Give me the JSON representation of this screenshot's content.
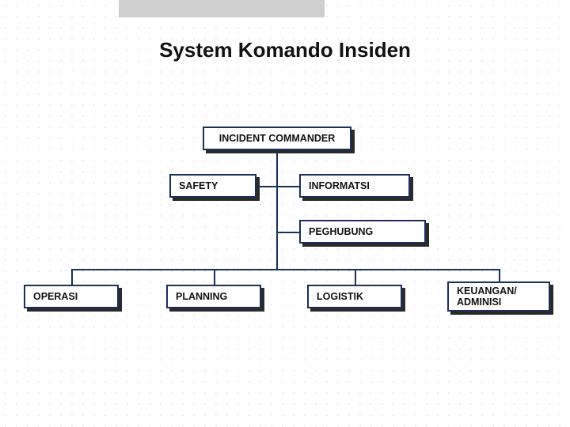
{
  "title": "System Komando  Insiden",
  "nodes": {
    "commander": "INCIDENT COMMANDER",
    "safety": "SAFETY",
    "info": "INFORMATSI",
    "liaison": "PEGHUBUNG",
    "ops": "OPERASI",
    "plan": "PLANNING",
    "log": "LOGISTIK",
    "fin": "KEUANGAN/ ADMINISI"
  }
}
